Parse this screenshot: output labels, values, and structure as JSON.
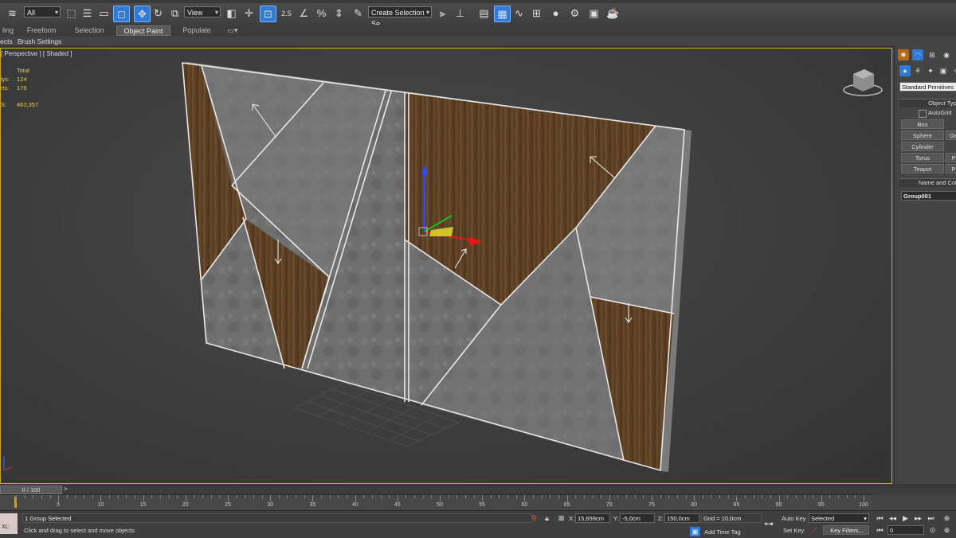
{
  "toolbar": {
    "selection_filter": "All",
    "reference_coord": "View",
    "snap_value": "2.5",
    "named_selection_placeholder": "Create Selection Se"
  },
  "ribbon": {
    "tabs": [
      "ling",
      "Freeform",
      "Selection",
      "Object Paint",
      "Populate"
    ],
    "active_tab": "Object Paint",
    "sub_left": "ects",
    "sub_label": "Brush Settings"
  },
  "viewport": {
    "label": "[ Perspective ] [ Shaded ]",
    "stats_header": "Total",
    "stats": [
      {
        "label": "lys:",
        "value": "124"
      },
      {
        "label": "rts:",
        "value": "176"
      },
      {
        "label": "S:",
        "value": "462,357"
      }
    ]
  },
  "command_panel": {
    "category": "Standard Primitives",
    "object_type_header": "Object Type",
    "autogrid_label": "AutoGrid",
    "buttons": [
      "Box",
      "Sphere",
      "Cylinder",
      "Torus",
      "Teapot"
    ],
    "cut_buttons": [
      "Ge",
      "P",
      "P"
    ],
    "name_color_header": "Name and Colo",
    "object_name": "Group001"
  },
  "timeline": {
    "frame_display": "0 / 100",
    "ticks": [
      "5",
      "10",
      "15",
      "20",
      "25",
      "30",
      "35",
      "40",
      "45",
      "50",
      "55",
      "60",
      "65",
      "70",
      "75",
      "80",
      "85",
      "90",
      "95",
      "100"
    ]
  },
  "status": {
    "maxscript": "XL:",
    "selection_info": "1 Group Selected",
    "prompt": "Click and drag to select and move objects",
    "x_label": "X:",
    "x_value": "15,659cm",
    "y_label": "Y:",
    "y_value": "-5,0cm",
    "z_label": "Z:",
    "z_value": "150,0cm",
    "grid": "Grid = 10,0cm",
    "add_time_tag": "Add Time Tag",
    "auto_key": "Auto Key",
    "set_key": "Set Key",
    "key_mode": "Selected",
    "key_filters": "Key Filters...",
    "current_frame": "0"
  },
  "colors": {
    "active_blue": "#2f7bd6",
    "viewport_border": "#c8a62b",
    "stats_yellow": "#e6d24a"
  }
}
